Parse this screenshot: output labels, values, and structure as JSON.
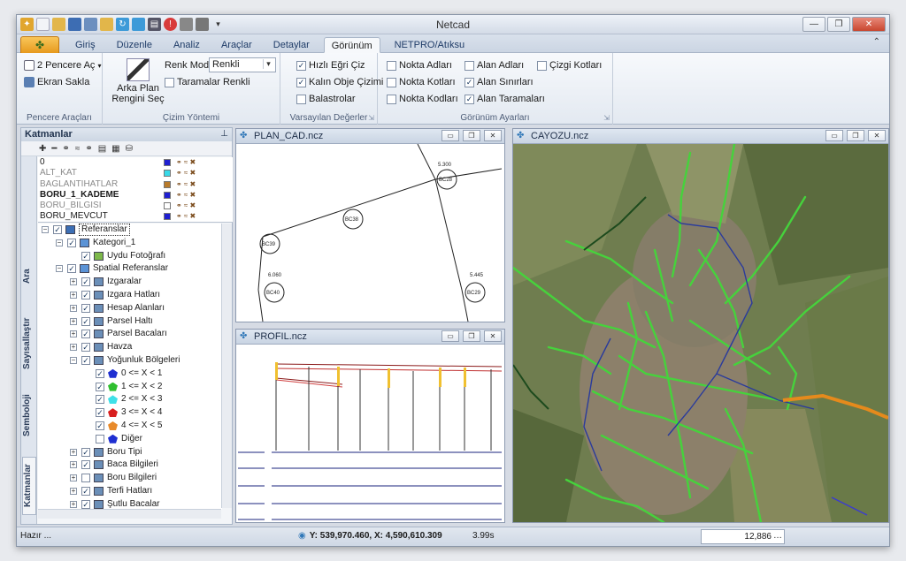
{
  "app": {
    "title": "Netcad"
  },
  "tabs": [
    "Giriş",
    "Düzenle",
    "Analiz",
    "Araçlar",
    "Detaylar",
    "Görünüm",
    "NETPRO/Atıksu"
  ],
  "active_tab": "Görünüm",
  "ribbon": {
    "pencere": {
      "btn1": "2 Pencere Aç",
      "btn2": "Ekran Sakla",
      "label": "Pencere Araçları"
    },
    "cizim": {
      "arkaplan_line1": "Arka Plan",
      "arkaplan_line2": "Rengini Seç",
      "renk_modu_label": "Renk Modu",
      "renk_modu_value": "Renkli",
      "taramalar": "Taramalar Renkli",
      "label": "Çizim Yöntemi"
    },
    "varsayilan": {
      "hizli": "Hızlı Eğri Çiz",
      "kalin": "Kalın Obje Çizimi",
      "balastrolar": "Balastrolar",
      "label": "Varsayılan Değerler"
    },
    "gorunum": {
      "nokta_adlari": "Nokta Adları",
      "nokta_kotlari": "Nokta Kotları",
      "nokta_kodlari": "Nokta Kodları",
      "alan_adlari": "Alan Adları",
      "alan_sinirlari": "Alan Sınırları",
      "alan_taramalari": "Alan Taramaları",
      "cizgi_kotlari": "Çizgi Kotları",
      "label": "Görünüm Ayarları"
    }
  },
  "layers_panel": {
    "title": "Katmanlar",
    "layers": [
      {
        "name": "0",
        "color": "#1f1fd1"
      },
      {
        "name": "ALT_KAT",
        "color": "#37d9e8"
      },
      {
        "name": "BAGLANTIHATLAR",
        "color": "#b87a2a"
      },
      {
        "name": "BORU_1_KADEME",
        "color": "#1f1fd1"
      },
      {
        "name": "BORU_BILGISI",
        "color": "#ffffff"
      },
      {
        "name": "BORU_MEVCUT",
        "color": "#1f1fd1"
      }
    ],
    "side_tabs": [
      "Katmanlar",
      "Semboloji",
      "Sayısallaştır",
      "Ara"
    ]
  },
  "tree": [
    {
      "label": "Referanslar",
      "level": 0,
      "expand": "-",
      "checked": true,
      "icon": "#3c6fb5",
      "selected": true
    },
    {
      "label": "Kategori_1",
      "level": 1,
      "expand": "-",
      "checked": true,
      "icon": "#5b93d6"
    },
    {
      "label": "Uydu Fotoğrafı",
      "level": 2,
      "expand": "",
      "checked": true,
      "icon": "#7db84a"
    },
    {
      "label": "Spatial Referanslar",
      "level": 1,
      "expand": "-",
      "checked": true,
      "icon": "#5b93d6"
    },
    {
      "label": "Izgaralar",
      "level": 2,
      "expand": "+",
      "checked": true,
      "icon": "#6b8fb8"
    },
    {
      "label": "Izgara Hatları",
      "level": 2,
      "expand": "+",
      "checked": true,
      "icon": "#6b8fb8"
    },
    {
      "label": "Hesap Alanları",
      "level": 2,
      "expand": "+",
      "checked": true,
      "icon": "#6b8fb8"
    },
    {
      "label": "Parsel Haltı",
      "level": 2,
      "expand": "+",
      "checked": true,
      "icon": "#6b8fb8"
    },
    {
      "label": "Parsel Bacaları",
      "level": 2,
      "expand": "+",
      "checked": true,
      "icon": "#6b8fb8"
    },
    {
      "label": "Havza",
      "level": 2,
      "expand": "+",
      "checked": true,
      "icon": "#6b8fb8"
    },
    {
      "label": "Yoğunluk Bölgeleri",
      "level": 2,
      "expand": "-",
      "checked": true,
      "icon": "#6b8fb8"
    },
    {
      "label": "0 <= X < 1",
      "level": 3,
      "expand": "",
      "checked": true,
      "icon": "#1f2fd1",
      "shape": "pent"
    },
    {
      "label": "1 <= X < 2",
      "level": 3,
      "expand": "",
      "checked": true,
      "icon": "#2fbf2f",
      "shape": "pent"
    },
    {
      "label": "2 <= X < 3",
      "level": 3,
      "expand": "",
      "checked": true,
      "icon": "#3fe0e8",
      "shape": "pent"
    },
    {
      "label": "3 <= X < 4",
      "level": 3,
      "expand": "",
      "checked": true,
      "icon": "#d81f1f",
      "shape": "pent"
    },
    {
      "label": "4 <= X < 5",
      "level": 3,
      "expand": "",
      "checked": true,
      "icon": "#e88a2a",
      "shape": "pent"
    },
    {
      "label": "Diğer",
      "level": 3,
      "expand": "",
      "checked": false,
      "icon": "#1f2fd1",
      "shape": "pent"
    },
    {
      "label": "Boru Tipi",
      "level": 2,
      "expand": "+",
      "checked": true,
      "icon": "#6b8fb8"
    },
    {
      "label": "Baca Bilgileri",
      "level": 2,
      "expand": "+",
      "checked": true,
      "icon": "#6b8fb8"
    },
    {
      "label": "Boru Bilgileri",
      "level": 2,
      "expand": "+",
      "checked": false,
      "icon": "#6b8fb8"
    },
    {
      "label": "Terfi Hatları",
      "level": 2,
      "expand": "+",
      "checked": true,
      "icon": "#6b8fb8"
    },
    {
      "label": "Şutlu Bacalar",
      "level": 2,
      "expand": "+",
      "checked": true,
      "icon": "#6b8fb8"
    }
  ],
  "windows": {
    "plan": {
      "title": "PLAN_CAD.ncz"
    },
    "profil": {
      "title": "PROFIL.ncz"
    },
    "cayozu": {
      "title": "CAYOZU.ncz"
    }
  },
  "plan_labels": {
    "manholes": [
      "BC28",
      "BC38",
      "BC39",
      "BC40",
      "BC29"
    ],
    "elevations": [
      "5.300",
      "6.060",
      "5.445"
    ]
  },
  "status": {
    "ready": "Hazır ...",
    "coords": "Y: 539,970.460, X: 4,590,610.309",
    "time": "3.99s",
    "scale": "12,886"
  }
}
